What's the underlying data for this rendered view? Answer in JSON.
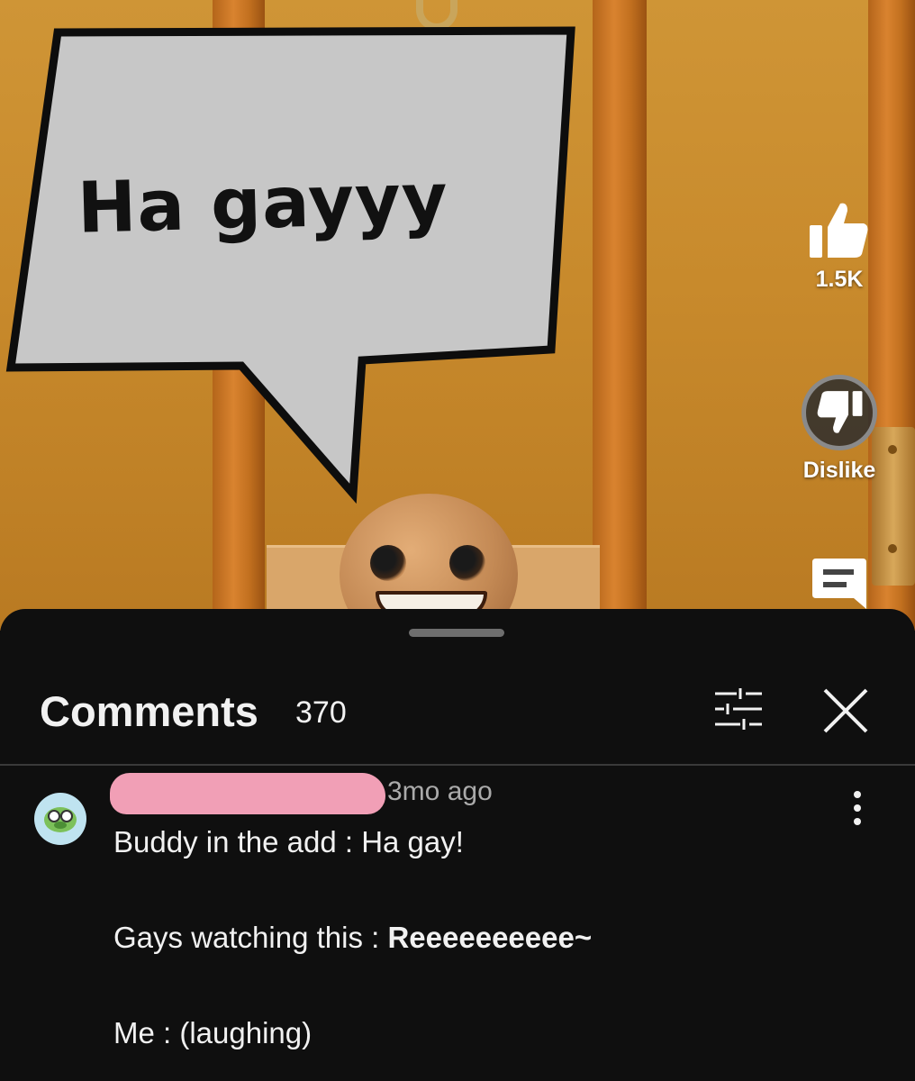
{
  "video": {
    "bubble_text": "Ha gayyy",
    "actions": {
      "like_count": "1.5K",
      "dislike_label": "Dislike"
    }
  },
  "comments_panel": {
    "title": "Comments",
    "count": "370",
    "comments": [
      {
        "author": "",
        "time": "3mo ago",
        "lines": [
          "Buddy in the add : Ha gay!",
          "",
          "Gays watching this : ",
          "",
          "Me : (laughing)"
        ],
        "bold_fragment": "Reeeeeeeeee~"
      }
    ]
  },
  "icons": [
    "thumbs-up-icon",
    "thumbs-down-icon",
    "comment-icon",
    "filter-icon",
    "close-icon",
    "more-vert-icon",
    "avatar-icon"
  ],
  "colors": {
    "sheet_bg": "#0f0f0f",
    "text": "#f1f1f1",
    "muted": "#aaaaaa",
    "redaction": "#f19fb6"
  }
}
